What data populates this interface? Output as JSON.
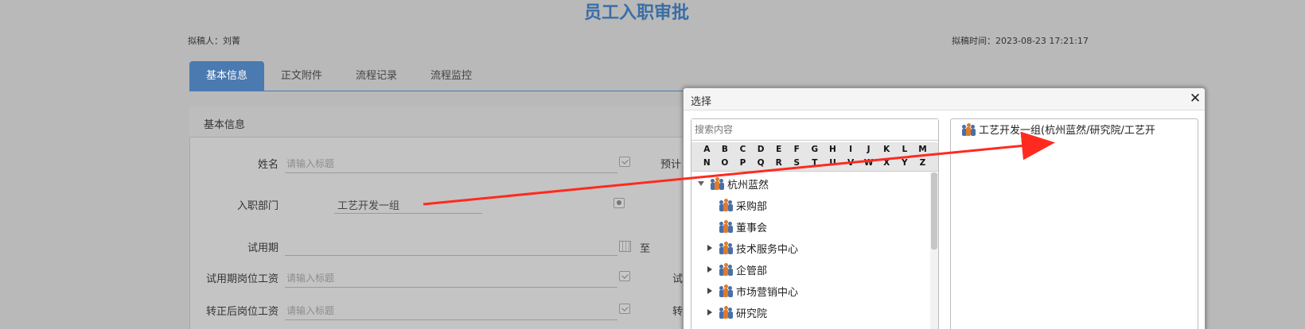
{
  "page": {
    "title": "员工入职审批",
    "drafter": "拟稿人：刘菁",
    "draft_time": "拟稿时间：2023-08-23 17:21:17"
  },
  "tabs": [
    {
      "label": "基本信息",
      "active": true
    },
    {
      "label": "正文附件",
      "active": false
    },
    {
      "label": "流程记录",
      "active": false
    },
    {
      "label": "流程监控",
      "active": false
    }
  ],
  "form": {
    "section_title": "基本信息",
    "name_label": "姓名",
    "name_placeholder": "请输入标题",
    "expected_label_partial": "预计",
    "dept_label": "入职部门",
    "dept_value": "工艺开发一组",
    "probation_label": "试用期",
    "probation_to": "至",
    "probation_salary_label": "试用期岗位工资",
    "probation_salary_placeholder": "请输入标题",
    "probation_salary_right_partial": "试",
    "regular_salary_label": "转正后岗位工资",
    "regular_salary_placeholder": "请输入标题",
    "regular_salary_right_partial": "转"
  },
  "dialog": {
    "title": "选择",
    "close_glyph": "✕",
    "search_placeholder": "搜索内容",
    "letters_row1": [
      "A",
      "B",
      "C",
      "D",
      "E",
      "F",
      "G",
      "H",
      "I",
      "J",
      "K",
      "L",
      "M"
    ],
    "letters_row2": [
      "N",
      "O",
      "P",
      "Q",
      "R",
      "S",
      "T",
      "U",
      "V",
      "W",
      "X",
      "Y",
      "Z"
    ],
    "tree": [
      {
        "label": "杭州蓝然",
        "expanded": true,
        "level": 0
      },
      {
        "label": "采购部",
        "expanded": null,
        "level": 1
      },
      {
        "label": "董事会",
        "expanded": null,
        "level": 1
      },
      {
        "label": "技术服务中心",
        "expanded": false,
        "level": 1
      },
      {
        "label": "企管部",
        "expanded": false,
        "level": 1
      },
      {
        "label": "市场营销中心",
        "expanded": false,
        "level": 1
      },
      {
        "label": "研究院",
        "expanded": false,
        "level": 1
      }
    ],
    "selected": [
      "工艺开发一组(杭州蓝然/研究院/工艺开"
    ]
  },
  "colors": {
    "accent": "#4a7ab0",
    "title": "#3a6ea5",
    "arrow": "#ff2a1f",
    "overlay_bg": "#b9b9b9"
  },
  "icons": {
    "org": "org-people-icon",
    "edit": "edit-check-icon",
    "person": "person-picker-icon",
    "calendar": "calendar-icon",
    "close": "close-icon"
  }
}
